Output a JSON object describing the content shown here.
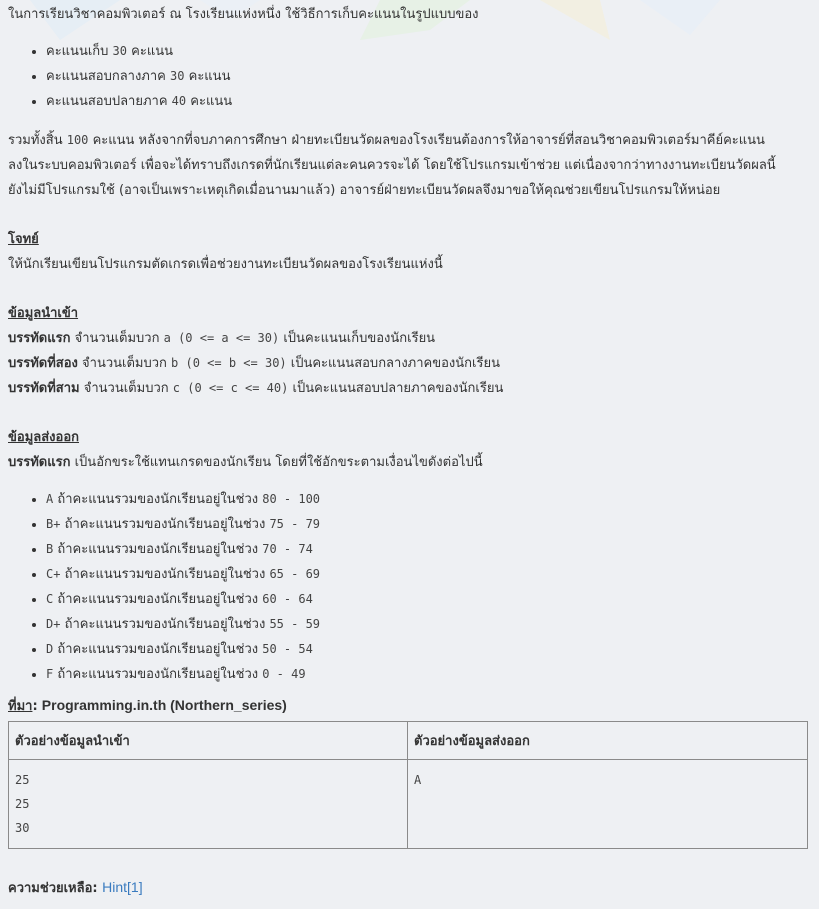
{
  "intro": {
    "text": "ในการเรียนวิชาคอมพิวเตอร์ ณ โรงเรียนแห่งหนึ่ง ใช้วิธีการเก็บคะแนนในรูปแบบของ",
    "bullets": [
      {
        "pre": "คะแนนเก็บ",
        "num": "30",
        "post": "คะแนน"
      },
      {
        "pre": "คะแนนสอบกลางภาค",
        "num": "30",
        "post": "คะแนน"
      },
      {
        "pre": "คะแนนสอบปลายภาค",
        "num": "40",
        "post": "คะแนน"
      }
    ],
    "para_pre": "รวมทั้งสิ้น",
    "para_num": "100",
    "para_line1": "คะแนน หลังจากที่จบภาคการศึกษา ฝ่ายทะเบียนวัดผลของโรงเรียนต้องการให้อาจารย์ที่สอนวิชาคอมพิวเตอร์มาคีย์คะแนน",
    "para_line2": "ลงในระบบคอมพิวเตอร์ เพื่อจะได้ทราบถึงเกรดที่นักเรียนแต่ละคนควรจะได้ โดยใช้โปรแกรมเข้าช่วย แต่เนื่องจากว่าทางงานทะเบียนวัดผลนี้",
    "para_line3": "ยังไม่มีโปรแกรมใช้ (อาจเป็นเพราะเหตุเกิดเมื่อนานมาแล้ว) อาจารย์ฝ่ายทะเบียนวัดผลจึงมาขอให้คุณช่วยเขียนโปรแกรมให้หน่อย"
  },
  "problem": {
    "heading": "โจทย์",
    "text": "ให้นักเรียนเขียนโปรแกรมตัดเกรดเพื่อช่วยงานทะเบียนวัดผลของโรงเรียนแห่งนี้"
  },
  "input": {
    "heading": "ข้อมูลนำเข้า",
    "lines": [
      {
        "label": "บรรทัดแรก",
        "pre": "จำนวนเต็มบวก",
        "code": "a (0 <= a <= 30)",
        "post": "เป็นคะแนนเก็บของนักเรียน"
      },
      {
        "label": "บรรทัดที่สอง",
        "pre": "จำนวนเต็มบวก",
        "code": "b (0 <= b <= 30)",
        "post": "เป็นคะแนนสอบกลางภาคของนักเรียน"
      },
      {
        "label": "บรรทัดที่สาม",
        "pre": "จำนวนเต็มบวก",
        "code": "c (0 <= c <= 40)",
        "post": "เป็นคะแนนสอบปลายภาคของนักเรียน"
      }
    ]
  },
  "output": {
    "heading": "ข้อมูลส่งออก",
    "line_label": "บรรทัดแรก",
    "line_text": "เป็นอักขระใช้แทนเกรดของนักเรียน โดยที่ใช้อักขระตามเงื่อนไขดังต่อไปนี้",
    "grades": [
      {
        "grade": "A",
        "text": "ถ้าคะแนนรวมของนักเรียนอยู่ในช่วง",
        "range": "80 - 100"
      },
      {
        "grade": "B+",
        "text": "ถ้าคะแนนรวมของนักเรียนอยู่ในช่วง",
        "range": "75 - 79"
      },
      {
        "grade": "B",
        "text": "ถ้าคะแนนรวมของนักเรียนอยู่ในช่วง",
        "range": "70 - 74"
      },
      {
        "grade": "C+",
        "text": "ถ้าคะแนนรวมของนักเรียนอยู่ในช่วง",
        "range": "65 - 69"
      },
      {
        "grade": "C",
        "text": "ถ้าคะแนนรวมของนักเรียนอยู่ในช่วง",
        "range": "60 - 64"
      },
      {
        "grade": "D+",
        "text": "ถ้าคะแนนรวมของนักเรียนอยู่ในช่วง",
        "range": "55 - 59"
      },
      {
        "grade": "D",
        "text": "ถ้าคะแนนรวมของนักเรียนอยู่ในช่วง",
        "range": "50 - 54"
      },
      {
        "grade": "F",
        "text": "ถ้าคะแนนรวมของนักเรียนอยู่ในช่วง",
        "range": "0 - 49"
      }
    ]
  },
  "source": {
    "label": "ที่มา",
    "colon": ":",
    "value": "Programming.in.th (Northern_series)"
  },
  "samples": {
    "input_header": "ตัวอย่างข้อมูลนำเข้า",
    "output_header": "ตัวอย่างข้อมูลส่งออก",
    "input_lines": [
      "25",
      "25",
      "30"
    ],
    "output_lines": [
      "A"
    ]
  },
  "help": {
    "label": "ความช่วยเหลือ:",
    "link": "Hint[1]"
  },
  "colors": {
    "background": "#eef0f3",
    "text": "#333333",
    "link": "#3a7bbf",
    "border": "#8a8a8a"
  }
}
